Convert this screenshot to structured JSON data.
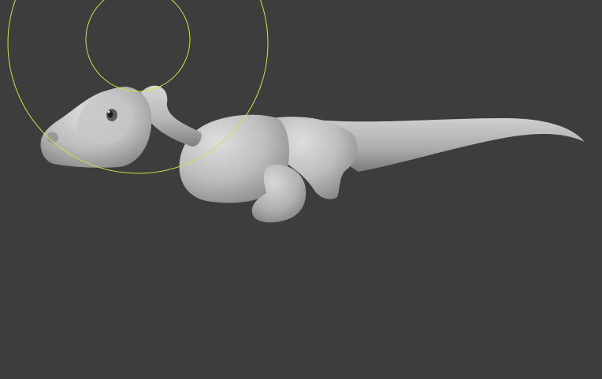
{
  "viewport": {
    "background_color": "#3d3d3d"
  },
  "scene": {
    "model": "dinosaur-sculpt",
    "model_color": "#b4b4b4",
    "brush_cursor_color": "#d8dc4a"
  }
}
